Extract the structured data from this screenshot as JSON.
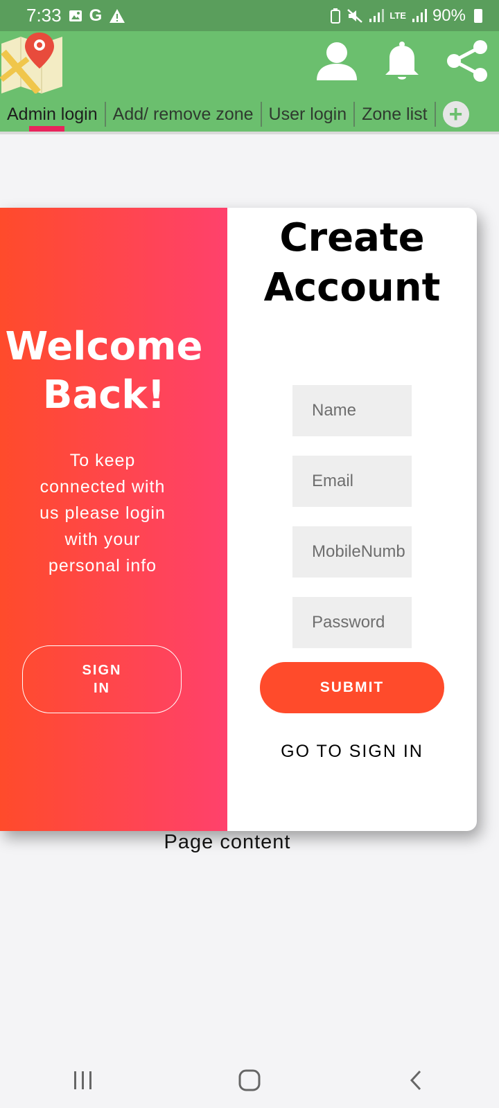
{
  "status_bar": {
    "time": "7:33",
    "left_icons": [
      "image-icon",
      "google-icon",
      "warning-icon"
    ],
    "network_label": "LTE",
    "battery": "90%"
  },
  "tabs": [
    {
      "label": "Admin login",
      "active": true
    },
    {
      "label": "Add/ remove zone",
      "active": false
    },
    {
      "label": "User login",
      "active": false
    },
    {
      "label": "Zone list",
      "active": false
    }
  ],
  "tab_add_label": "+",
  "welcome": {
    "title_line1": "Welcome",
    "title_line2": "Back!",
    "text": "To keep connected with us please login with your personal info",
    "signin_line1": "SIGN",
    "signin_line2": "IN"
  },
  "form": {
    "title_line1": "Create",
    "title_line2": "Account",
    "name_placeholder": "Name",
    "email_placeholder": "Email",
    "mobile_placeholder": "MobileNumber",
    "password_placeholder": "Password",
    "submit_label": "SUBMIT",
    "goto_signin": "GO TO SIGN IN"
  },
  "page_content": "Page content",
  "colors": {
    "status_bar": "#5a9e5c",
    "app_bar": "#6bbf6e",
    "tab_indicator": "#e8245c",
    "gradient_start": "#ff4b2b",
    "gradient_end": "#ff416c",
    "submit": "#ff4b2b"
  }
}
